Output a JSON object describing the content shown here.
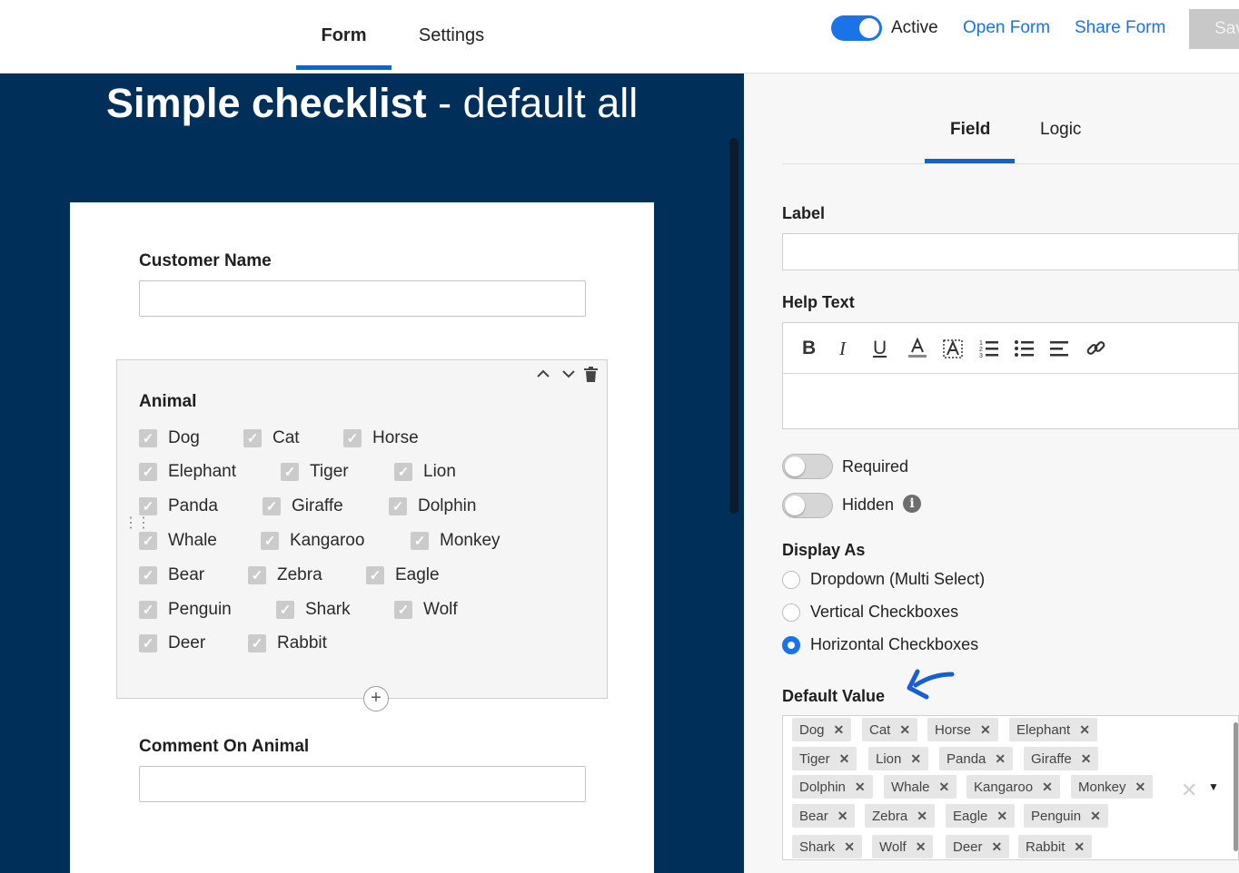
{
  "header": {
    "tabs": [
      {
        "label": "Form"
      },
      {
        "label": "Settings"
      }
    ],
    "active_label": "Active",
    "open_form": "Open Form",
    "share_form": "Share Form",
    "save_label": "Sav"
  },
  "form": {
    "title_bold": "Simple checklist",
    "title_rest": " - default all",
    "customer_name_label": "Customer Name",
    "animal_label": "Animal",
    "animals": [
      {
        "name": "Dog"
      },
      {
        "name": "Cat"
      },
      {
        "name": "Horse"
      },
      {
        "name": "Elephant"
      },
      {
        "name": "Tiger"
      },
      {
        "name": "Lion"
      },
      {
        "name": "Panda"
      },
      {
        "name": "Giraffe"
      },
      {
        "name": "Dolphin"
      },
      {
        "name": "Whale"
      },
      {
        "name": "Kangaroo"
      },
      {
        "name": "Monkey"
      },
      {
        "name": "Bear"
      },
      {
        "name": "Zebra"
      },
      {
        "name": "Eagle"
      },
      {
        "name": "Penguin"
      },
      {
        "name": "Shark"
      },
      {
        "name": "Wolf"
      },
      {
        "name": "Deer"
      },
      {
        "name": "Rabbit"
      }
    ],
    "comment_label": "Comment On Animal"
  },
  "panel": {
    "tabs": [
      {
        "label": "Field"
      },
      {
        "label": "Logic"
      }
    ],
    "label_heading": "Label",
    "help_text_heading": "Help Text",
    "toolbar": {
      "bold": "B",
      "italic": "I",
      "underline": "U"
    },
    "required_label": "Required",
    "hidden_label": "Hidden",
    "display_as_heading": "Display As",
    "display_options": [
      {
        "label": "Dropdown (Multi Select)",
        "selected": false
      },
      {
        "label": "Vertical Checkboxes",
        "selected": false
      },
      {
        "label": "Horizontal Checkboxes",
        "selected": true
      }
    ],
    "default_value_heading": "Default Value",
    "default_values": [
      "Dog",
      "Cat",
      "Horse",
      "Elephant",
      "Tiger",
      "Lion",
      "Panda",
      "Giraffe",
      "Dolphin",
      "Whale",
      "Kangaroo",
      "Monkey",
      "Bear",
      "Zebra",
      "Eagle",
      "Penguin",
      "Shark",
      "Wolf",
      "Deer",
      "Rabbit"
    ]
  },
  "colors": {
    "brand_dark": "#00305a",
    "accent": "#1a73e8",
    "tab_underline": "#1565c0"
  }
}
